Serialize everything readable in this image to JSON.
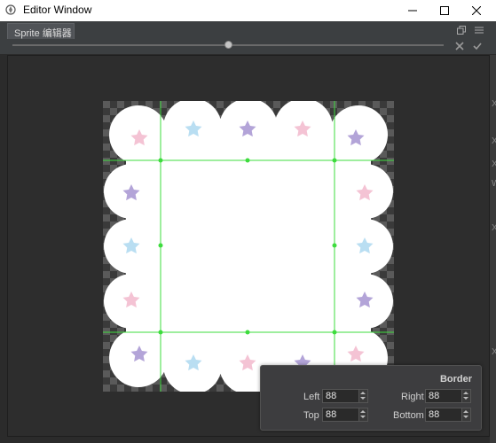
{
  "window": {
    "title": "Editor Window"
  },
  "tab": {
    "label": "Sprite 编辑器"
  },
  "toolbar": {
    "zoom_level": 0.5
  },
  "border_panel": {
    "title": "Border",
    "left_label": "Left",
    "left_value": "88",
    "right_label": "Right",
    "right_value": "88",
    "top_label": "Top",
    "top_value": "88",
    "bottom_label": "Bottom",
    "bottom_value": "88"
  },
  "right_edge_glyphs": [
    "X",
    "X",
    "X",
    "W",
    "X",
    "X"
  ],
  "colors": {
    "guide": "#3ddc3d",
    "star_pink": "#f4c3d4",
    "star_blue": "#b9def2",
    "star_purple": "#b3a4d8"
  }
}
